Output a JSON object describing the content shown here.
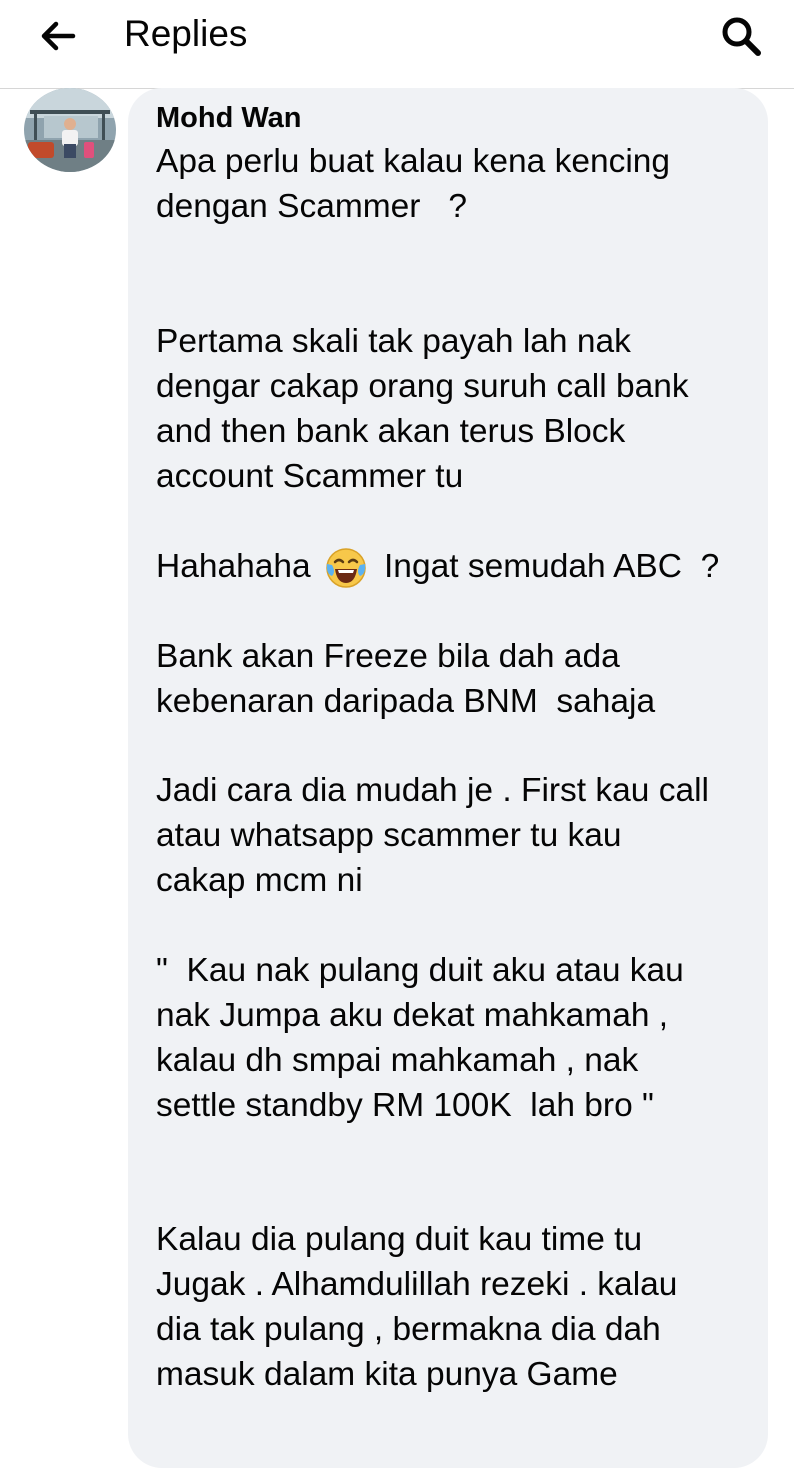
{
  "header": {
    "back_icon": "arrow-left-icon",
    "title": "Replies",
    "search_icon": "search-icon"
  },
  "comment": {
    "author": "Mohd Wan",
    "avatar": "avatar-photo",
    "emoji": "tears-of-joy-emoji",
    "lines": [
      "Apa perlu buat kalau kena kencing",
      "dengan Scammer   ?",
      "Pertama skali tak payah lah nak",
      "dengar cakap orang suruh call bank",
      "and then bank akan terus Block",
      "account Scammer tu",
      "Hahahaha",
      "Ingat semudah ABC  ?",
      "Bank akan Freeze bila dah ada",
      "kebenaran daripada BNM  sahaja",
      "Jadi cara dia mudah je . First kau call",
      "atau whatsapp scammer tu kau",
      "cakap mcm ni",
      "\"  Kau nak pulang duit aku atau kau",
      "nak Jumpa aku dekat mahkamah ,",
      "kalau dh smpai mahkamah , nak",
      "settle standby RM 100K  lah bro \"",
      "Kalau dia pulang duit kau time tu",
      "Jugak . Alhamdulillah rezeki . kalau",
      "dia tak pulang , bermakna dia dah",
      "masuk dalam kita punya Game"
    ]
  },
  "colors": {
    "bubble": "#f0f2f5",
    "text": "#050505",
    "divider": "#d6d6d6"
  }
}
